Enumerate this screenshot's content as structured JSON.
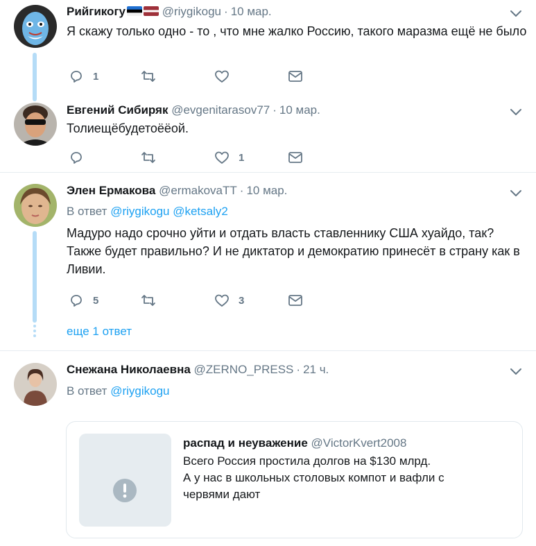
{
  "colors": {
    "accent": "#1da1f2",
    "muted": "#657786",
    "thread_line": "#b5dcf7",
    "divider": "#e6ecf0"
  },
  "tweets": [
    {
      "name": "Рийгикогу",
      "handle": "@riygikogu",
      "separator": "·",
      "time": "10 мар.",
      "flags": [
        "estonia-flag",
        "latvia-flag"
      ],
      "text": "Я скажу только одно - то , что мне жалко Россию, такого маразма ещё не было",
      "counts": {
        "reply": "1",
        "retweet": "",
        "like": ""
      }
    },
    {
      "name": "Евгений Сибиряк",
      "handle": "@evgenitarasov77",
      "separator": "·",
      "time": "10 мар.",
      "text": "Толиещёбудетоёёой.",
      "counts": {
        "reply": "",
        "retweet": "",
        "like": "1"
      }
    },
    {
      "name": "Элен Ермакова",
      "handle": "@ermakovaTT",
      "separator": "·",
      "time": "10 мар.",
      "replying_prefix": "В ответ",
      "replying_to": [
        "@riygikogu",
        "@ketsaly2"
      ],
      "text": "Мадуро надо срочно уйти и отдать власть ставленнику США хуайдо, так? Также будет правильно? И не диктатор и демократию принесёт в страну как в Ливии.",
      "counts": {
        "reply": "5",
        "retweet": "",
        "like": "3"
      },
      "more_replies": "еще 1 ответ"
    },
    {
      "name": "Снежана Николаевна",
      "handle": "@ZERNO_PRESS",
      "separator": "·",
      "time": "21 ч.",
      "replying_prefix": "В ответ",
      "replying_to": [
        "@riygikogu"
      ],
      "quote": {
        "name": "распад и неуважение",
        "handle": "@VictorKvert2008",
        "lines": [
          "Всего Россия простила долгов на $130 млрд.",
          "А у нас в школьных столовых  компот и вафли с",
          "червями дают"
        ]
      }
    }
  ]
}
